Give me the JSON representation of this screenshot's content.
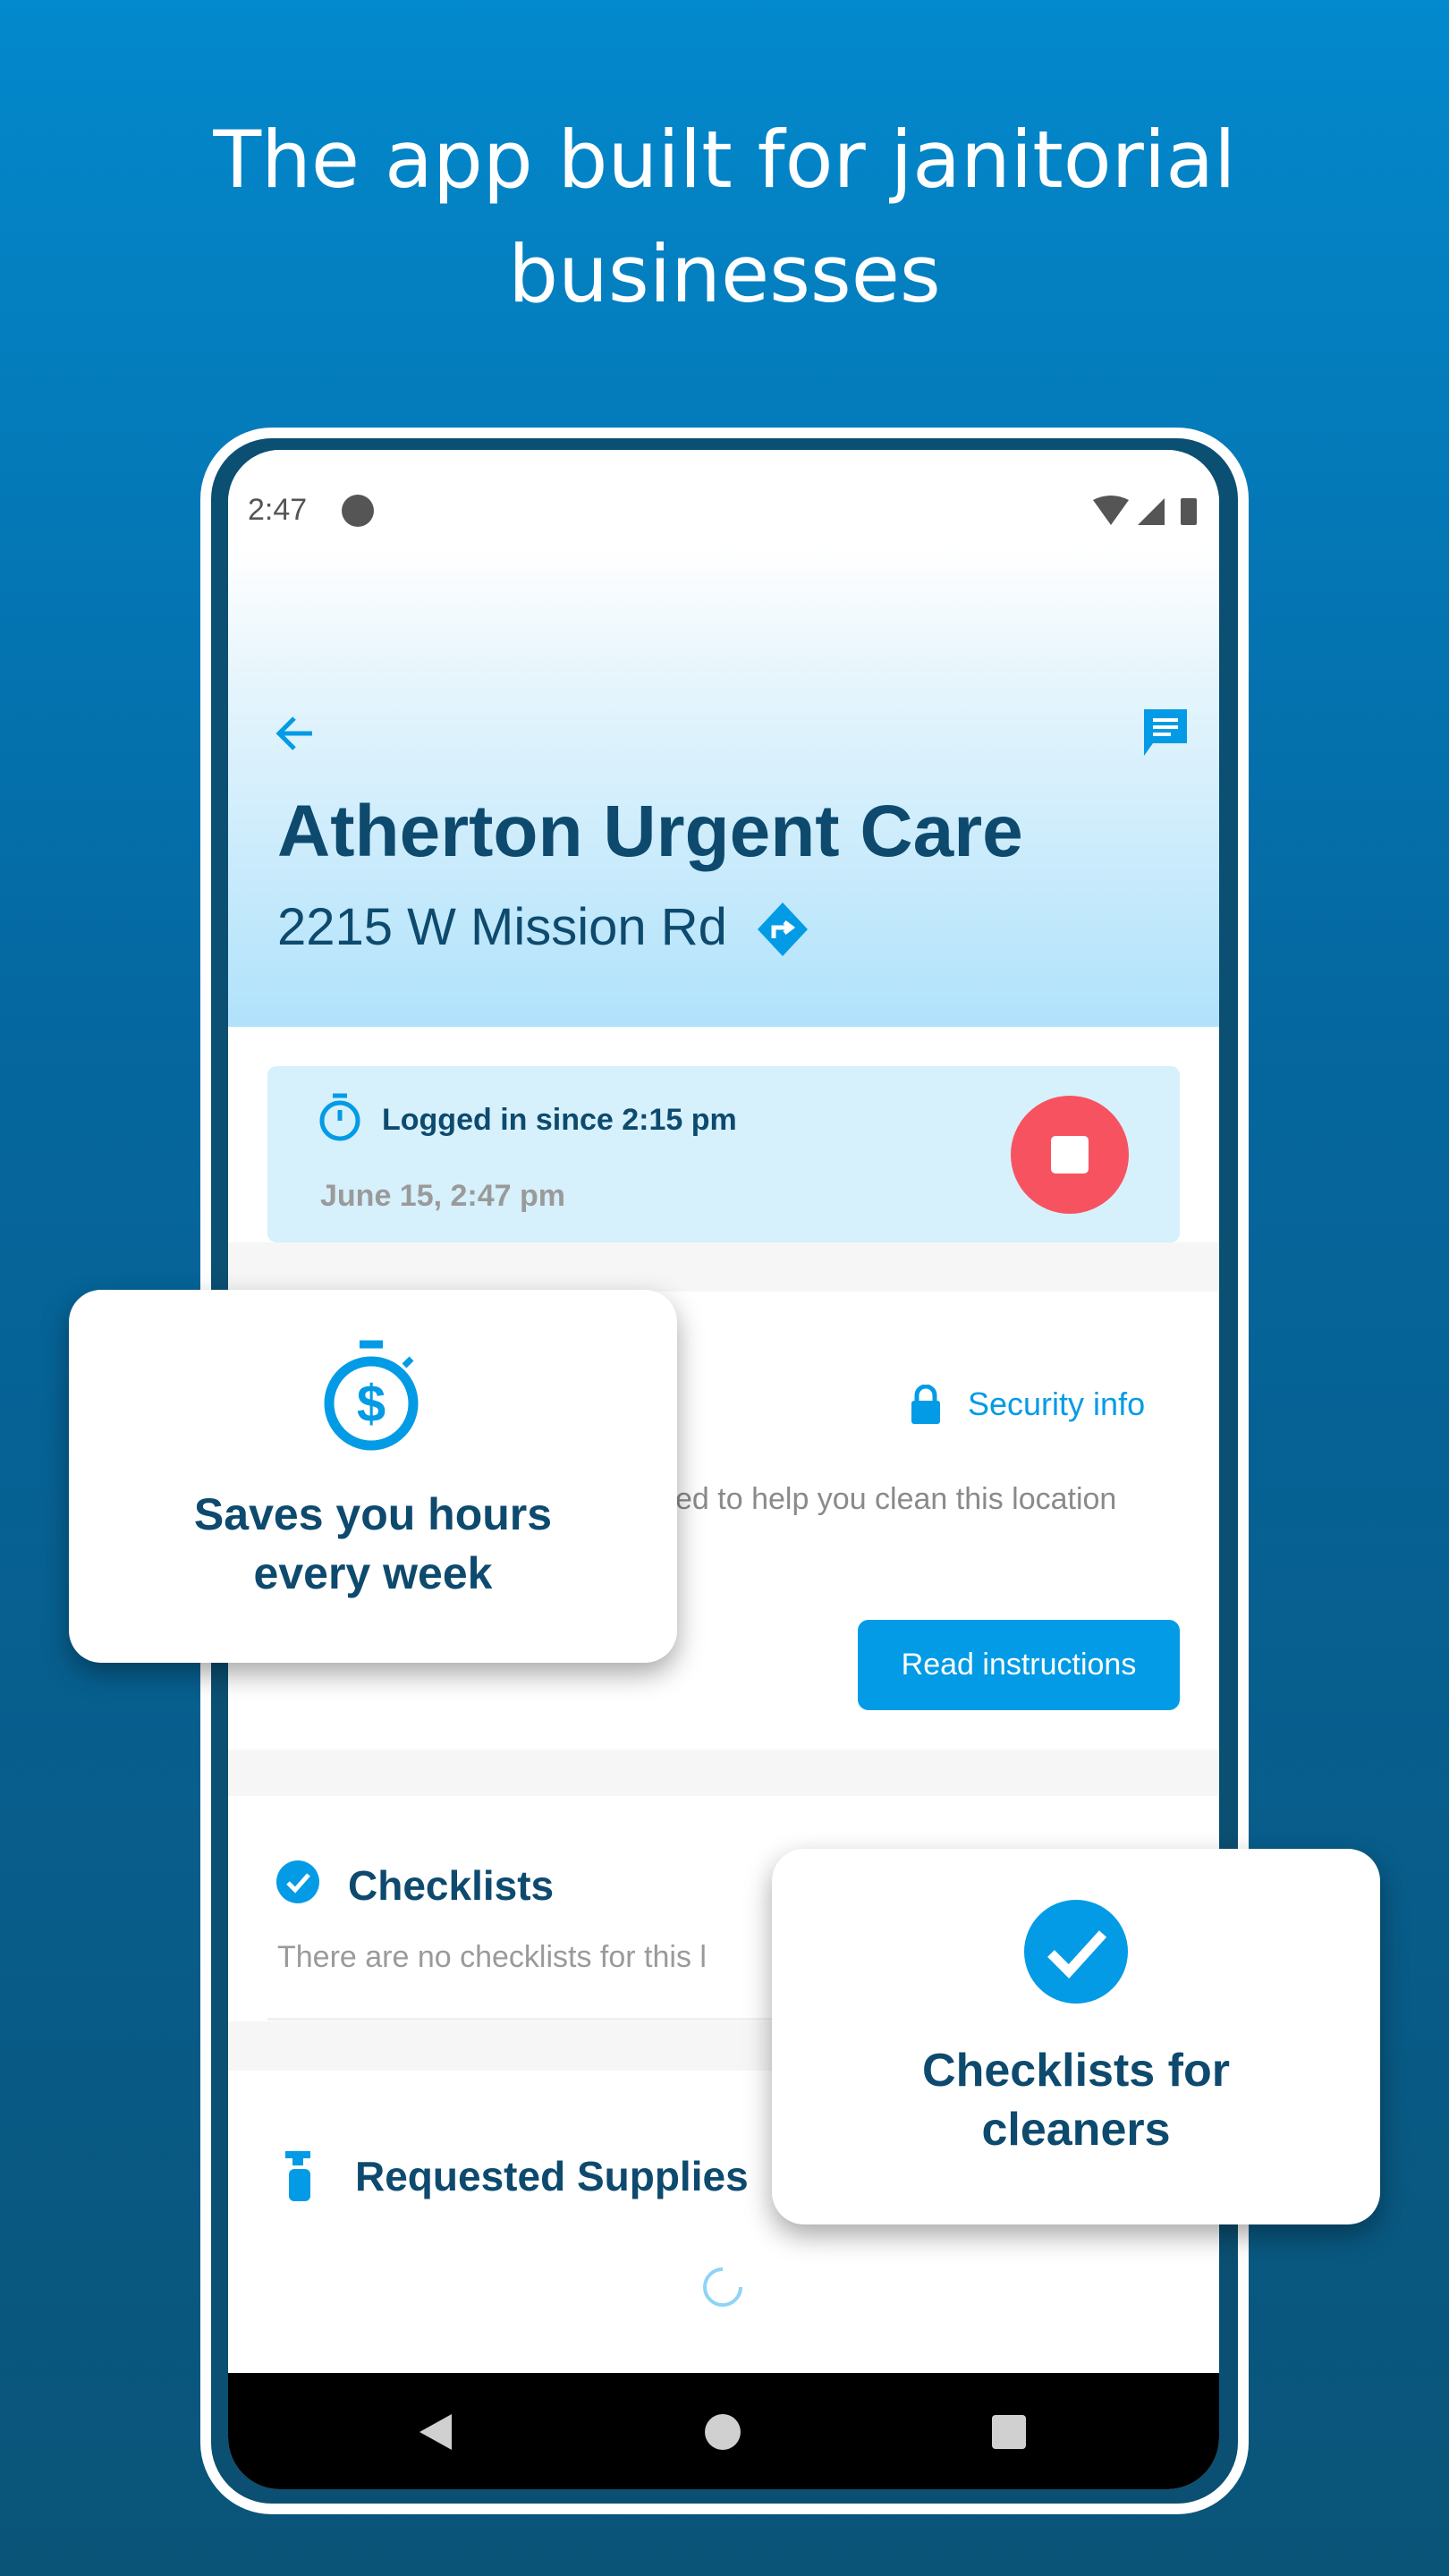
{
  "headline": {
    "line1": "The app built for janitorial",
    "line2": "businesses"
  },
  "status_bar": {
    "time": "2:47"
  },
  "location": {
    "name": "Atherton Urgent Care",
    "address": "2215 W Mission Rd"
  },
  "session": {
    "logged_in": "Logged in since 2:15 pm",
    "current": "June 15, 2:47 pm"
  },
  "instructions": {
    "security_label": "Security info",
    "description_fragment": "ed to help you clean this location",
    "button": "Read instructions"
  },
  "checklists": {
    "title": "Checklists",
    "empty": "There are no checklists for this l"
  },
  "supplies": {
    "title": "Requested Supplies"
  },
  "feature_cards": [
    {
      "text_line1": "Saves you hours",
      "text_line2": "every week",
      "icon": "stopwatch-dollar-icon"
    },
    {
      "text_line1": "Checklists for",
      "text_line2": "cleaners",
      "icon": "check-circle-icon"
    }
  ],
  "colors": {
    "accent": "#039be5",
    "text": "#0d4a6e",
    "stop": "#f7525f"
  }
}
